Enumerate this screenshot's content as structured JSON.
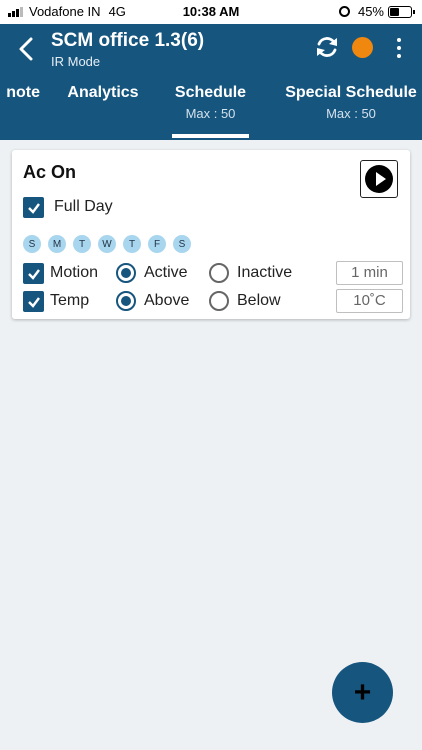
{
  "status_bar": {
    "carrier": "Vodafone IN",
    "network": "4G",
    "time": "10:38 AM",
    "battery": "45%",
    "battery_level": 0.45
  },
  "header": {
    "title": "SCM office 1.3(6)",
    "subtitle": "IR Mode",
    "status_color": "#f0870f"
  },
  "tabs": [
    {
      "label": "note"
    },
    {
      "label": "Analytics"
    },
    {
      "label": "Schedule",
      "sub": "Max : 50",
      "active": true
    },
    {
      "label": "Special Schedule",
      "sub": "Max : 50"
    }
  ],
  "schedule_card": {
    "title": "Ac On",
    "full_day": {
      "label": "Full Day",
      "checked": true
    },
    "days": [
      "S",
      "M",
      "T",
      "W",
      "T",
      "F",
      "S"
    ],
    "motion": {
      "label": "Motion",
      "checked": true,
      "options": [
        "Active",
        "Inactive"
      ],
      "selected": "Active",
      "value": "1 min"
    },
    "temp": {
      "label": "Temp",
      "checked": true,
      "options": [
        "Above",
        "Below"
      ],
      "selected": "Above",
      "value": "10˚C"
    }
  },
  "fab_label": "+",
  "colors": {
    "primary": "#16557e",
    "day_chip": "#a9d6ef",
    "background": "#eef1f4"
  }
}
